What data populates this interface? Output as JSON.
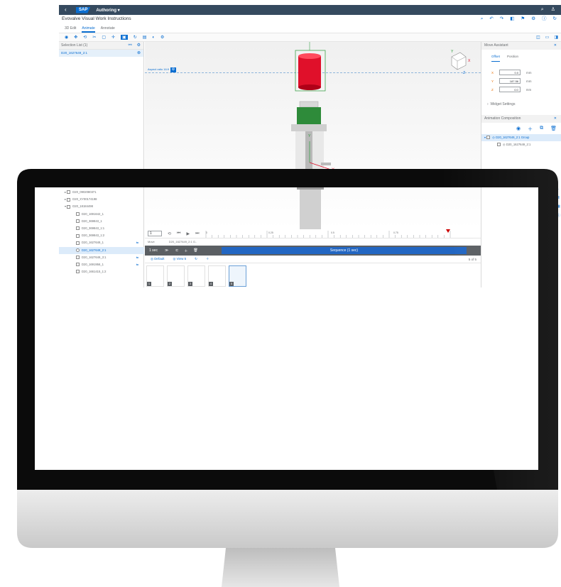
{
  "shell": {
    "back_icon": "back-arrow-icon",
    "logo": "SAP",
    "title": "Authoring ▾",
    "right_icons": [
      "search-icon",
      "user-icon"
    ]
  },
  "app": {
    "title": "Evovalve Visual Work Instructions",
    "header_icons": [
      "search-icon",
      "undo-icon",
      "redo-icon",
      "share-icon",
      "flag-icon",
      "settings-icon",
      "help-icon",
      "refresh-icon"
    ]
  },
  "tabs": [
    {
      "label": "3D Edit",
      "active": false
    },
    {
      "label": "Animate",
      "active": true
    },
    {
      "label": "Annotate",
      "active": false
    }
  ],
  "toolbar": {
    "left_icons": [
      "eye-icon",
      "pan-icon",
      "orbit-icon",
      "scissors-icon",
      "box-icon",
      "move-icon",
      "select-icon",
      "rotate-icon",
      "camera-icon",
      "light-icon",
      "gear-icon"
    ],
    "right_icons": [
      "panel-left-icon",
      "panel-center-icon",
      "panel-right-icon"
    ]
  },
  "left_panel": {
    "header": "Selection List (1)",
    "selected_item": "D20_1627649_2:1",
    "tree": [
      {
        "label": "D20_0902080371",
        "level": 1,
        "expand": "▸",
        "selected": false,
        "icon": false
      },
      {
        "label": "D20_XY00174198",
        "level": 1,
        "expand": "▸",
        "selected": false,
        "icon": false
      },
      {
        "label": "D20_18184498",
        "level": 1,
        "expand": "▾",
        "selected": false,
        "icon": false
      },
      {
        "label": "D20_1691642_1",
        "level": 2,
        "expand": "",
        "selected": false,
        "icon": false
      },
      {
        "label": "D20_369843_1",
        "level": 2,
        "expand": "",
        "selected": false,
        "icon": false
      },
      {
        "label": "D20_369843_1:1",
        "level": 2,
        "expand": "",
        "selected": false,
        "icon": false
      },
      {
        "label": "D20_369843_1:2",
        "level": 2,
        "expand": "",
        "selected": false,
        "icon": false
      },
      {
        "label": "D20_1627649_1",
        "level": 2,
        "expand": "",
        "selected": false,
        "icon": true
      },
      {
        "label": "D20_1627649_2:1",
        "level": 2,
        "expand": "",
        "selected": true,
        "icon": false
      },
      {
        "label": "D20_1627649_3:1",
        "level": 2,
        "expand": "",
        "selected": false,
        "icon": true
      },
      {
        "label": "D20_1691956_1",
        "level": 2,
        "expand": "",
        "selected": false,
        "icon": true
      },
      {
        "label": "D20_1661415_1:2",
        "level": 2,
        "expand": "",
        "selected": false,
        "icon": false
      }
    ]
  },
  "viewport": {
    "aspect_label": "Aspect ratio 16:9"
  },
  "timeline": {
    "frame_value": "1",
    "ticks": [
      "0",
      "0.25",
      "0.5",
      "0.75"
    ],
    "move_label": "Move",
    "move_target": "D20_1627649_2:1 G..",
    "duration": "1 sec",
    "sequence_label": "Sequence (1 sec)",
    "views_left": [
      "Default",
      "View 5"
    ],
    "view_count": "5 of 5",
    "thumbnail_numbers": [
      "1",
      "2",
      "3",
      "4",
      "5"
    ]
  },
  "right_panel": {
    "header": "Move Assistant",
    "tabs": [
      "Offset",
      "Position"
    ],
    "fields": [
      {
        "axis": "X",
        "value": "0.0",
        "unit": "mm"
      },
      {
        "axis": "Y",
        "value": "187.56",
        "unit": "mm"
      },
      {
        "axis": "Z",
        "value": "0.0",
        "unit": "mm"
      }
    ],
    "widget_settings": "Widget Settings",
    "anim_header": "Animation Composition",
    "anim_group": "D20_1627649_2:1 Group",
    "anim_child": "D20_1627649_2:1"
  },
  "colors": {
    "shell": "#354a5f",
    "accent": "#0a6ed1",
    "selected_part": "#e0102a",
    "green_part": "#2e8b3a",
    "bezel": "#0b0b0b"
  }
}
